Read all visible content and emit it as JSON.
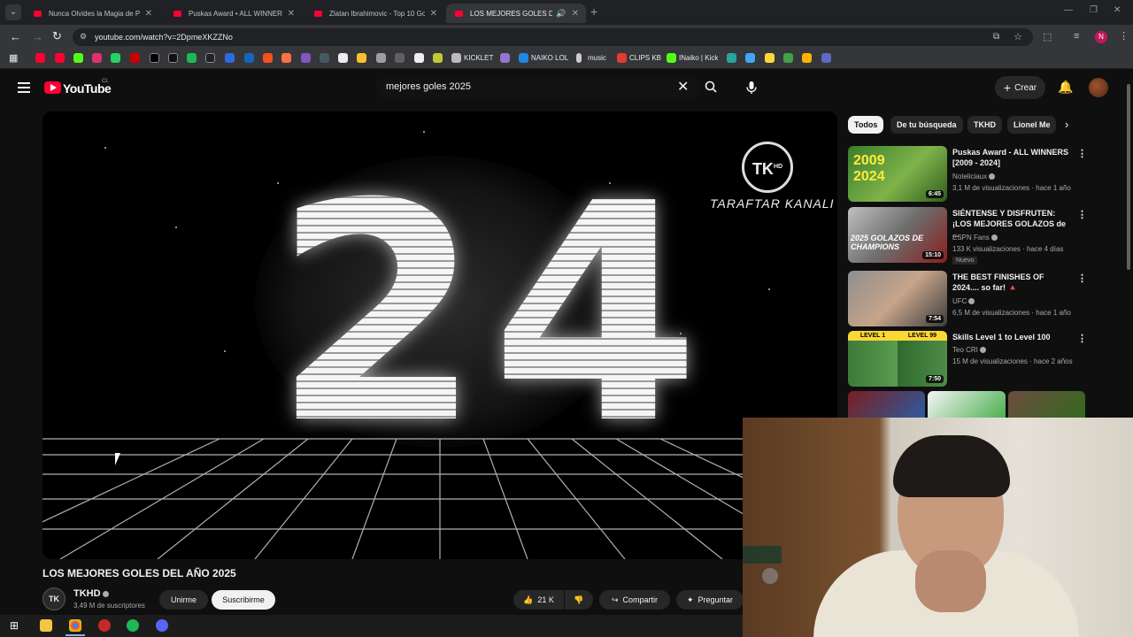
{
  "browser": {
    "tabs": [
      {
        "title": "Nunca Olvides la Magia de Pau"
      },
      {
        "title": "Puskas Award • ALL WINNERS |"
      },
      {
        "title": "Zlatan Ibrahimovic - Top 10 Go"
      },
      {
        "title": "LOS MEJORES GOLES DEL A"
      }
    ],
    "url": "youtube.com/watch?v=2DpmeXKZZNo",
    "bookmarks": [
      "KICKLET",
      "NAIKO LOL",
      "music",
      "CLIPS KB",
      "INaiko | Kick"
    ]
  },
  "youtube": {
    "logo_text": "YouTube",
    "country": "CL",
    "search_value": "mejores goles 2025",
    "create_label": "Crear"
  },
  "player": {
    "overlay_number": "24",
    "channel_logo": "TK",
    "channel_logo_sup": "HD",
    "channel_overlay": "TARAFTAR KANALI"
  },
  "video": {
    "title": "LOS MEJORES GOLES DEL AÑO 2025",
    "channel": "TKHD",
    "channel_avatar": "TK",
    "subscribers": "3,49 M de suscriptores",
    "join_label": "Unirme",
    "subscribe_label": "Suscribirme",
    "likes": "21 K",
    "share_label": "Compartir",
    "ask_label": "Preguntar"
  },
  "chips": [
    "Todos",
    "De tu búsqueda",
    "TKHD",
    "Lionel Me"
  ],
  "recommendations": [
    {
      "title": "Puskas Award - ALL WINNERS [2009 - 2024]",
      "channel": "Noteliciaux",
      "meta": "3,1 M de visualizaciones · hace 1 año",
      "duration": "6:45",
      "thumb_text": "2009\n2024"
    },
    {
      "title": "SIÉNTENSE Y DISFRUTEN: ¡LOS MEJORES GOLAZOS de ...",
      "channel": "ESPN Fans",
      "meta": "133 K visualizaciones · hace 4 días",
      "duration": "15:10",
      "badge": "Nuevo",
      "thumb_text": "2025 GOLAZOS DE CHAMPIONS"
    },
    {
      "title": "THE BEST FINISHES OF 2024.... so far! 🔺",
      "channel": "UFC",
      "meta": "6,5 M de visualizaciones · hace 1 año",
      "duration": "7:54"
    },
    {
      "title": "Skills Level 1 to Level 100",
      "channel": "Teo CRI",
      "meta": "15 M de visualizaciones · hace 2 años",
      "duration": "7:50",
      "thumb_left": "LEVEL 1",
      "thumb_right": "LEVEL 99"
    }
  ]
}
